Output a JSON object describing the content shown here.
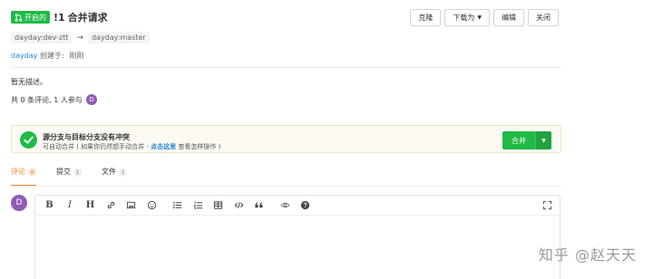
{
  "header": {
    "status": "开启的",
    "number": "!1",
    "title": "合并请求"
  },
  "actions": {
    "clone": "克隆",
    "download": "下载为",
    "edit": "编辑",
    "close": "关闭"
  },
  "branches": {
    "source": "dayday:dev-ztt",
    "arrow": "→",
    "target": "dayday:master"
  },
  "meta": {
    "author": "dayday",
    "created_label": "创建于:",
    "time": "刚刚"
  },
  "description": "暂无描述。",
  "stats": {
    "text": "共 0 条评论, 1 人参与",
    "avatar_letter": "D"
  },
  "merge": {
    "title": "源分支与目标分支没有冲突",
    "hint_prefix": "可自动合并 ( 如果你仍然想手动合并 - ",
    "hint_link": "点击这里",
    "hint_suffix": " 查看怎样操作 )",
    "button": "合并",
    "accent": "#21ba45"
  },
  "tabs": [
    {
      "label": "评论",
      "count": "0",
      "active": true
    },
    {
      "label": "提交",
      "count": "1",
      "active": false
    },
    {
      "label": "文件",
      "count": "1",
      "active": false
    }
  ],
  "editor": {
    "avatar_letter": "D",
    "tools": [
      "bold",
      "italic",
      "heading",
      "link",
      "image",
      "emoji",
      "unordered-list",
      "ordered-list",
      "table",
      "code",
      "quote",
      "preview",
      "help"
    ]
  },
  "watermark": "知乎 @赵天天"
}
